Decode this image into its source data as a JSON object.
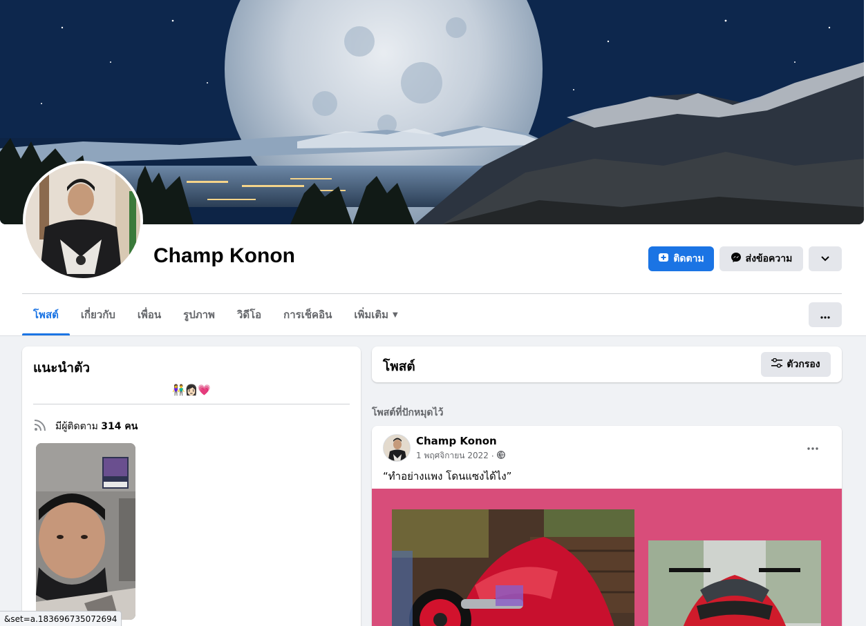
{
  "profile": {
    "name": "Champ Konon",
    "follow_label": "ติดตาม",
    "message_label": "ส่งข้อความ"
  },
  "tabs": [
    {
      "label": "โพสต์",
      "active": true
    },
    {
      "label": "เกี่ยวกับ"
    },
    {
      "label": "เพื่อน"
    },
    {
      "label": "รูปภาพ"
    },
    {
      "label": "วิดีโอ"
    },
    {
      "label": "การเช็คอิน"
    },
    {
      "label": "เพิ่มเติม"
    }
  ],
  "intro": {
    "title": "แนะนำตัว",
    "bio": "👫👩🏻💗",
    "followers_prefix": "มีผู้ติดตาม ",
    "followers_count": "314",
    "followers_suffix": " คน"
  },
  "posts_header": {
    "title": "โพสต์",
    "filter_label": "ตัวกรอง"
  },
  "pinned": {
    "label": "โพสต์ที่ปักหมุดไว้"
  },
  "post": {
    "author": "Champ Konon",
    "date": "1 พฤศจิกายน 2022",
    "separator": "·",
    "text": "“ทำอย่างแพง โดนแซงได้ไง”"
  },
  "status_bar": {
    "url_fragment": "&set=a.183696735072694"
  },
  "colors": {
    "accent": "#1b74e4",
    "post_background": "#d84d7a"
  },
  "icons": {
    "follow": "follow-plus-icon",
    "messenger": "messenger-icon",
    "chevron": "chevron-down-icon",
    "more": "more-dots-icon",
    "filter": "filter-sliders-icon",
    "rss": "rss-icon",
    "globe": "globe-icon"
  }
}
